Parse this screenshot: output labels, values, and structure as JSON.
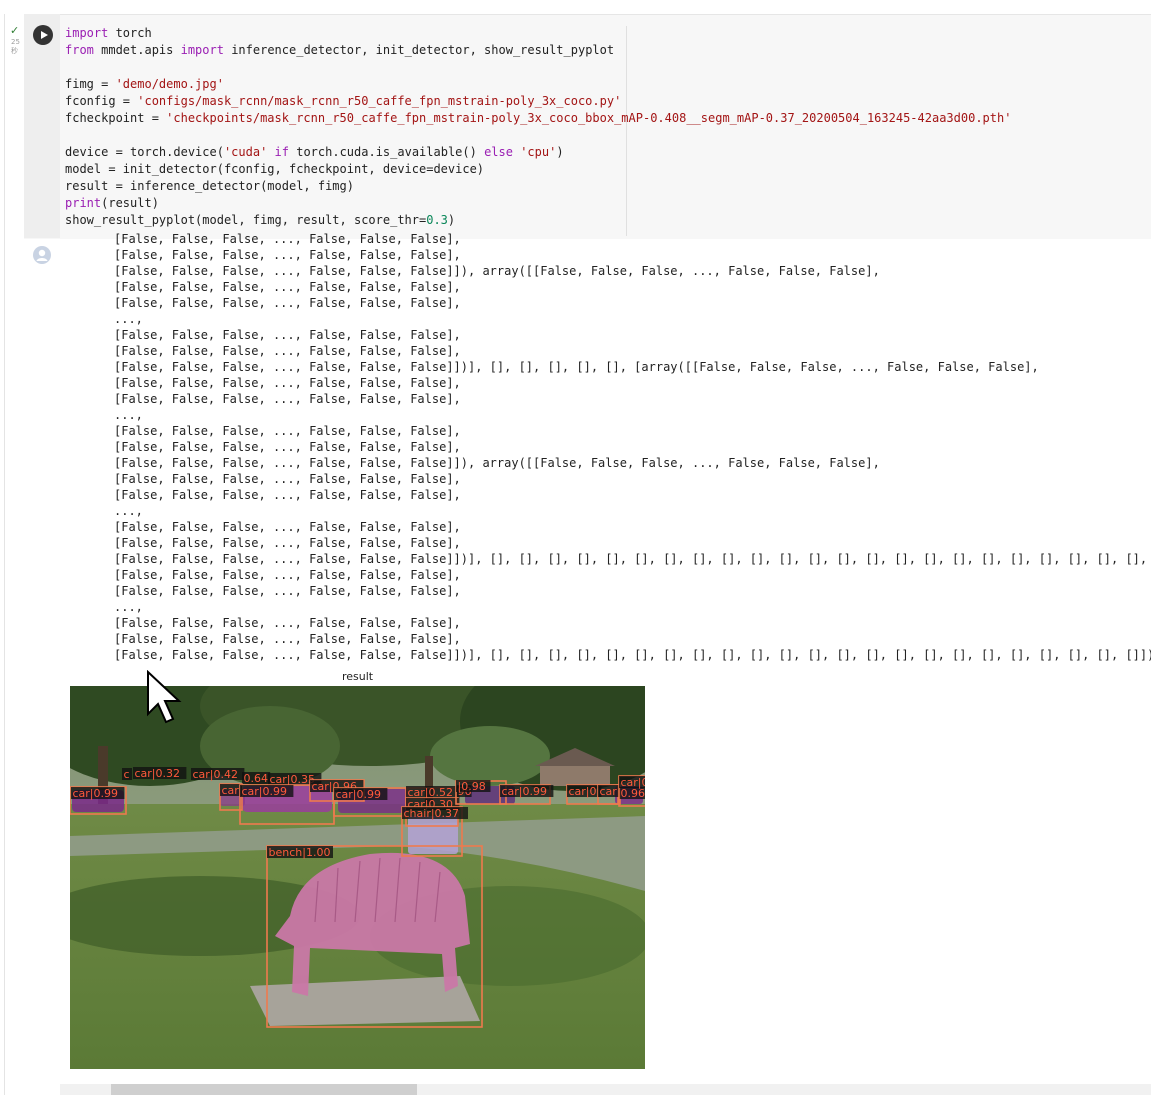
{
  "cell": {
    "status_check": "✓",
    "exec_time_line1": "25",
    "exec_time_line2": "秒",
    "code": {
      "l1_kw": "import",
      "l1_rest": " torch",
      "l2_kw": "from",
      "l2_mid": " mmdet.apis ",
      "l2_kw2": "import",
      "l2_rest": " inference_detector, init_detector, show_result_pyplot",
      "l3_pre": "fimg = ",
      "l3_str": "'demo/demo.jpg'",
      "l4_pre": "fconfig = ",
      "l4_str": "'configs/mask_rcnn/mask_rcnn_r50_caffe_fpn_mstrain-poly_3x_coco.py'",
      "l5_pre": "fcheckpoint = ",
      "l5_str": "'checkpoints/mask_rcnn_r50_caffe_fpn_mstrain-poly_3x_coco_bbox_mAP-0.408__segm_mAP-0.37_20200504_163245-42aa3d00.pth'",
      "l6_pre": "device = torch.device(",
      "l6_s1": "'cuda'",
      "l6_kw1": " if",
      "l6_mid": " torch.cuda.is_available() ",
      "l6_kw2": "else",
      "l6_s2": " 'cpu'",
      "l6_end": ")",
      "l7": "model = init_detector(fconfig, fcheckpoint, device=device)",
      "l8": "result = inference_detector(model, fimg)",
      "l9_kw": "print",
      "l9_rest": "(result)",
      "l10_pre": "show_result_pyplot(model, fimg, result, score_thr=",
      "l10_num": "0.3",
      "l10_end": ")"
    }
  },
  "output_lines": [
    "[False, False, False, ..., False, False, False],",
    "[False, False, False, ..., False, False, False],",
    "[False, False, False, ..., False, False, False]]), array([[False, False, False, ..., False, False, False],",
    "[False, False, False, ..., False, False, False],",
    "[False, False, False, ..., False, False, False],",
    "...,",
    "[False, False, False, ..., False, False, False],",
    "[False, False, False, ..., False, False, False],",
    "[False, False, False, ..., False, False, False]])], [], [], [], [], [], [array([[False, False, False, ..., False, False, False],",
    "[False, False, False, ..., False, False, False],",
    "[False, False, False, ..., False, False, False],",
    "...,",
    "[False, False, False, ..., False, False, False],",
    "[False, False, False, ..., False, False, False],",
    "[False, False, False, ..., False, False, False]]), array([[False, False, False, ..., False, False, False],",
    "[False, False, False, ..., False, False, False],",
    "[False, False, False, ..., False, False, False],",
    "...,",
    "[False, False, False, ..., False, False, False],",
    "[False, False, False, ..., False, False, False],",
    "[False, False, False, ..., False, False, False]])], [], [], [], [], [], [], [], [], [], [], [], [], [], [], [], [], [], [], [], [], [], [], [], [],",
    "[False, False, False, ..., False, False, False],",
    "[False, False, False, ..., False, False, False],",
    "...,",
    "[False, False, False, ..., False, False, False],",
    "[False, False, False, ..., False, False, False],",
    "[False, False, False, ..., False, False, False]])], [], [], [], [], [], [], [], [], [], [], [], [], [], [], [], [], [], [], [], [], [], [], []])"
  ],
  "plot": {
    "title": "result",
    "detections": [
      "car|0.99",
      "c",
      "car|0.32",
      "car|0.42",
      "0.64",
      "car|0.35",
      "car",
      "car|0.99",
      "car|0.96",
      "car|0.99",
      "car|0.52",
      "96",
      "car|0.30",
      "|0.98",
      "car|0.99",
      "car|0",
      "car",
      "0.96",
      "99",
      "car|0.42",
      "chair|0.37",
      "bench|1.00"
    ]
  },
  "colors": {
    "box": "#ee7a4e",
    "label_bg": "#111111",
    "label_text": "#ff5a3c",
    "bench_mask": "#c978a6",
    "car_mask": "#7a2a8a",
    "chair_mask": "#b4a2d6",
    "keyword": "#9a1fb3",
    "string": "#a31515",
    "number": "#098658"
  }
}
